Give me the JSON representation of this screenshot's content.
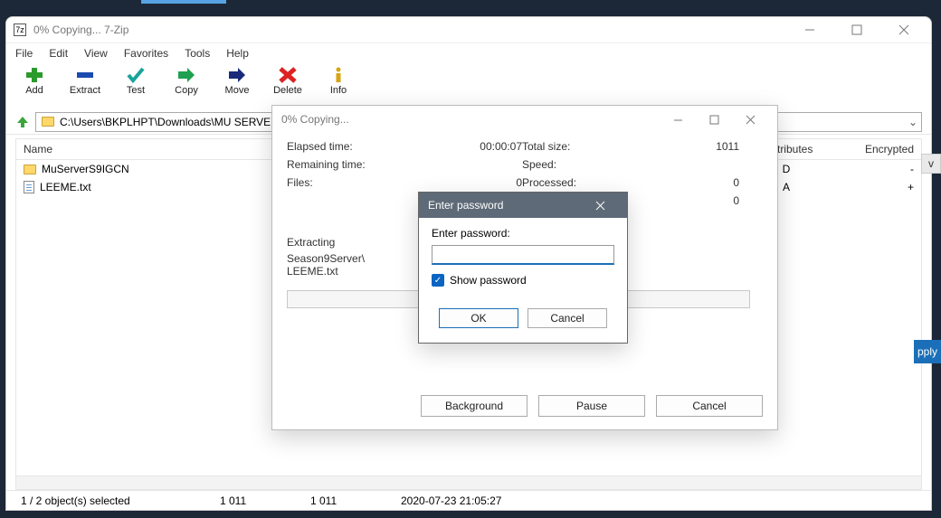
{
  "app": {
    "title": "0% Copying... 7-Zip"
  },
  "menus": [
    "File",
    "Edit",
    "View",
    "Favorites",
    "Tools",
    "Help"
  ],
  "toolbar": [
    {
      "id": "add",
      "label": "Add"
    },
    {
      "id": "extract",
      "label": "Extract"
    },
    {
      "id": "test",
      "label": "Test"
    },
    {
      "id": "copy",
      "label": "Copy"
    },
    {
      "id": "move",
      "label": "Move"
    },
    {
      "id": "delete",
      "label": "Delete"
    },
    {
      "id": "info",
      "label": "Info"
    }
  ],
  "path": "C:\\Users\\BKPLHPT\\Downloads\\MU SERVER\\",
  "columns": {
    "name": "Name",
    "attributes": "Attributes",
    "encrypted": "Encrypted"
  },
  "files": [
    {
      "name": "MuServerS9IGCN",
      "type": "folder",
      "attr": "D",
      "enc": "-"
    },
    {
      "name": "LEEME.txt",
      "type": "file",
      "attr": "A",
      "enc": "+"
    }
  ],
  "status": {
    "selection": "1 / 2 object(s) selected",
    "s1": "1 011",
    "s2": "1 011",
    "date": "2020-07-23 21:05:27"
  },
  "copy_dialog": {
    "title": "0% Copying...",
    "labels": {
      "elapsed": "Elapsed time:",
      "remaining": "Remaining time:",
      "files": "Files:",
      "total": "Total size:",
      "speed": "Speed:",
      "processed": "Processed:"
    },
    "values": {
      "elapsed": "00:00:07",
      "remaining": "",
      "files": "0",
      "total": "1011",
      "speed": "",
      "processed": "0",
      "extra": "0"
    },
    "extracting_label": "Extracting",
    "extracting_path": "Season9Server\\\nLEEME.txt",
    "buttons": {
      "background": "Background",
      "pause": "Pause",
      "cancel": "Cancel"
    }
  },
  "pwd_dialog": {
    "title": "Enter password",
    "label": "Enter password:",
    "value": "",
    "show_label": "Show password",
    "show_checked": true,
    "ok": "OK",
    "cancel": "Cancel"
  },
  "sidebits": {
    "v": "v",
    "apply": "pply"
  }
}
